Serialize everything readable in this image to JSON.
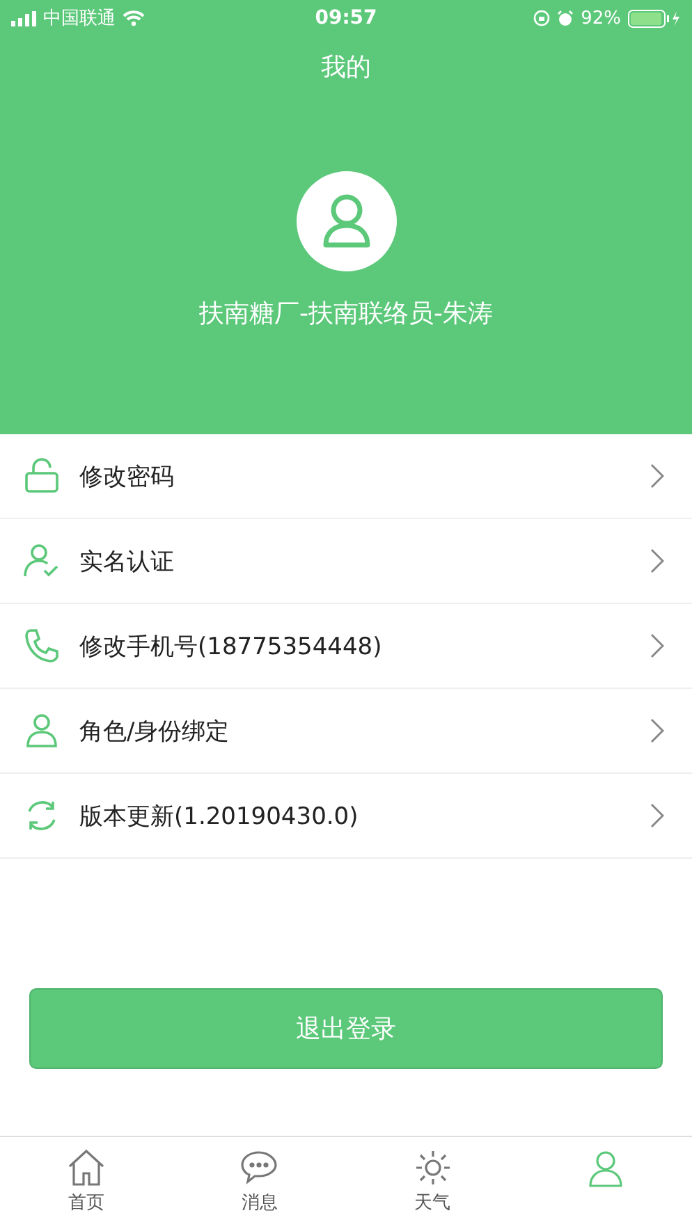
{
  "status_bar": {
    "carrier": "中国联通",
    "time": "09:57",
    "battery": "92%"
  },
  "header": {
    "title": "我的",
    "user_name": "扶南糖厂-扶南联络员-朱涛"
  },
  "menu": [
    {
      "kind": "lock",
      "label": "修改密码"
    },
    {
      "kind": "verify",
      "label": "实名认证"
    },
    {
      "kind": "phone",
      "label": "修改手机号(18775354448)"
    },
    {
      "kind": "person",
      "label": "角色/身份绑定"
    },
    {
      "kind": "refresh",
      "label": "版本更新(1.20190430.0)"
    }
  ],
  "logout_button": "退出登录",
  "tab_bar": [
    {
      "kind": "home",
      "label": "首页",
      "selected": false
    },
    {
      "kind": "chat",
      "label": "消息",
      "selected": false
    },
    {
      "kind": "weather",
      "label": "天气",
      "selected": false
    },
    {
      "kind": "person",
      "selected": true
    }
  ]
}
